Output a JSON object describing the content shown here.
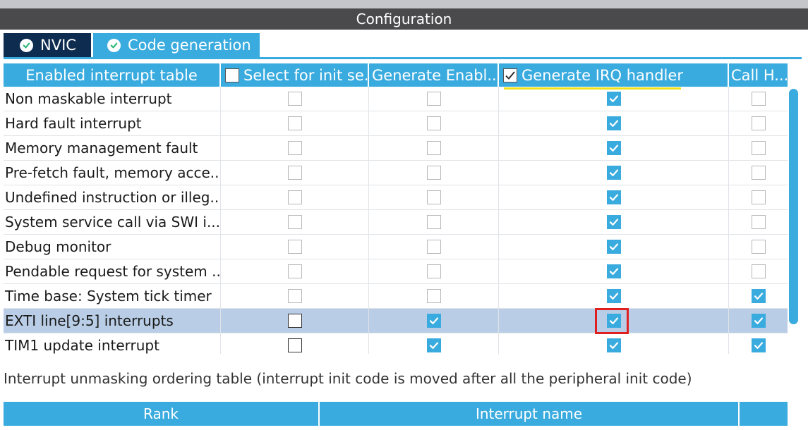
{
  "window": {
    "title": "Configuration"
  },
  "tabs": [
    {
      "label": "NVIC",
      "active": false
    },
    {
      "label": "Code generation",
      "active": true
    }
  ],
  "table": {
    "columns": [
      {
        "label": "Enabled interrupt table",
        "has_checkbox": false
      },
      {
        "label": "Select for init se...",
        "has_checkbox": true,
        "checked": false
      },
      {
        "label": "Generate Enabl...",
        "has_checkbox": false
      },
      {
        "label": "Generate IRQ handler",
        "has_checkbox": true,
        "checked": true
      },
      {
        "label": "Call H...",
        "has_checkbox": false
      }
    ],
    "rows": [
      {
        "name": "Non maskable interrupt",
        "select_init": "disabled-off",
        "gen_enable": "disabled-off",
        "gen_irq": "on",
        "call_hal": "disabled-off"
      },
      {
        "name": "Hard fault interrupt",
        "select_init": "disabled-off",
        "gen_enable": "disabled-off",
        "gen_irq": "on",
        "call_hal": "disabled-off"
      },
      {
        "name": "Memory management fault",
        "select_init": "disabled-off",
        "gen_enable": "disabled-off",
        "gen_irq": "on",
        "call_hal": "disabled-off"
      },
      {
        "name": "Pre-fetch fault, memory acce...",
        "select_init": "disabled-off",
        "gen_enable": "disabled-off",
        "gen_irq": "on",
        "call_hal": "disabled-off"
      },
      {
        "name": "Undefined instruction or illeg...",
        "select_init": "disabled-off",
        "gen_enable": "disabled-off",
        "gen_irq": "on",
        "call_hal": "disabled-off"
      },
      {
        "name": "System service call via SWI i...",
        "select_init": "disabled-off",
        "gen_enable": "disabled-off",
        "gen_irq": "on",
        "call_hal": "disabled-off"
      },
      {
        "name": "Debug monitor",
        "select_init": "disabled-off",
        "gen_enable": "disabled-off",
        "gen_irq": "on",
        "call_hal": "disabled-off"
      },
      {
        "name": "Pendable request for system ...",
        "select_init": "disabled-off",
        "gen_enable": "disabled-off",
        "gen_irq": "on",
        "call_hal": "disabled-off"
      },
      {
        "name": "Time base: System tick timer",
        "select_init": "disabled-off",
        "gen_enable": "disabled-off",
        "gen_irq": "on",
        "call_hal": "on"
      },
      {
        "name": "EXTI line[9:5] interrupts",
        "select_init": "off",
        "gen_enable": "on",
        "gen_irq": "on",
        "call_hal": "on",
        "selected": true,
        "highlighted_cell": "gen_irq"
      },
      {
        "name": "TIM1 update interrupt",
        "select_init": "off",
        "gen_enable": "on",
        "gen_irq": "on",
        "call_hal": "on"
      }
    ]
  },
  "ordering": {
    "label": "Interrupt unmasking ordering table (interrupt init code is moved after all the peripheral init code)",
    "columns": [
      "Rank",
      "Interrupt name",
      ""
    ]
  },
  "colors": {
    "accent": "#3aabdf",
    "tab_dark": "#0d2c4f",
    "title_bar": "#4a4a4d",
    "row_selected": "#b9cee6",
    "annotation_red": "#e02020",
    "annotation_yellow": "#f0e21a"
  },
  "icons": {
    "tab": "check-circle-icon",
    "checkbox_checked": "checkmark-icon"
  }
}
